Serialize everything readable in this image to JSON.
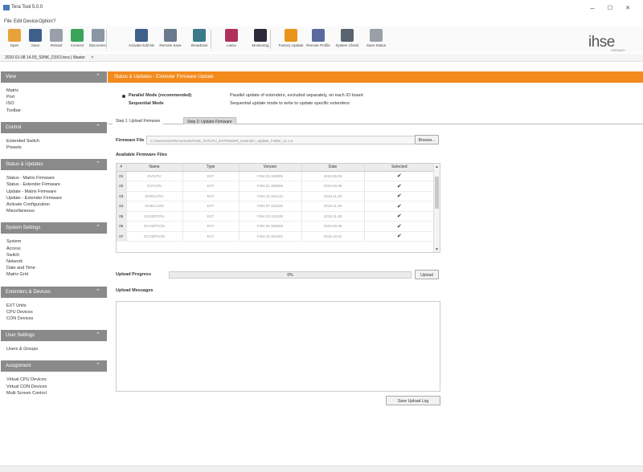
{
  "window": {
    "title": "Tera Tool 5.0.0",
    "controls": [
      "–",
      "☐",
      "✕"
    ]
  },
  "menu": [
    "File",
    "Edit",
    "Device",
    "Option",
    "?"
  ],
  "toolbar": [
    {
      "label": "Open",
      "icon": "open-folder-icon",
      "color": "#e8a23a"
    },
    {
      "label": "Save",
      "icon": "save-icon",
      "color": "#3e5f8a"
    },
    {
      "label": "Reload",
      "icon": "reload-icon",
      "color": "#9aa0a8"
    },
    {
      "label": "Connect",
      "icon": "connect-icon",
      "color": "#3aa55a"
    },
    {
      "label": "Disconnect",
      "icon": "disconnect-icon",
      "color": "#8a96a4"
    },
    {
      "label": "Activate Edit Mode",
      "icon": "edit-mode-icon",
      "color": "#3e5f8a"
    },
    {
      "label": "Remote Save",
      "icon": "remote-save-icon",
      "color": "#6a7a8c"
    },
    {
      "label": "Broadcast",
      "icon": "broadcast-icon",
      "color": "#3a7a8a"
    },
    {
      "label": "Lasso",
      "icon": "lasso-icon",
      "color": "#b0305a"
    },
    {
      "label": "Monitoring",
      "icon": "monitoring-icon",
      "color": "#2a2a3a"
    },
    {
      "label": "Factory Update",
      "icon": "factory-update-icon",
      "color": "#e8941a"
    },
    {
      "label": "Remote Profile",
      "icon": "remote-profile-icon",
      "color": "#5a6aa0"
    },
    {
      "label": "System Check",
      "icon": "system-check-icon",
      "color": "#5a6470"
    },
    {
      "label": "Save Status",
      "icon": "save-status-icon",
      "color": "#9aa0a8"
    }
  ],
  "brand": {
    "name": "ihse",
    "sub": "GERMANY"
  },
  "doc_tab": {
    "label": "2020-01-08 14.59_S0NK_D3X3.tera | Master",
    "close": "×"
  },
  "sidebar": {
    "sections": [
      {
        "title": "View",
        "items": [
          "Matrix",
          "Port",
          "ISO",
          "Toolbar"
        ]
      },
      {
        "title": "Control",
        "items": [
          "Extended Switch",
          "Presets"
        ]
      },
      {
        "title": "Status & Updates",
        "items": [
          "Status - Matrix Firmware",
          "Status - Extender Firmware",
          "Update - Matrix Firmware",
          "Update - Extender Firmware",
          "Activate Configuration",
          "Miscellaneous"
        ]
      },
      {
        "title": "System Settings",
        "items": [
          "System",
          "Access",
          "Switch",
          "Network",
          "Date and Time",
          "Matrix Grid"
        ]
      },
      {
        "title": "Extenders & Devices",
        "items": [
          "EXT Units",
          "CPU Devices",
          "CON Devices"
        ]
      },
      {
        "title": "User Settings",
        "items": [
          "Users & Groups"
        ]
      },
      {
        "title": "Assignment",
        "items": [
          "Virtual CPU Devices",
          "Virtual CON Devices",
          "Multi Screen Control"
        ]
      }
    ]
  },
  "main": {
    "header": "Status & Updates - Extender Firmware Update",
    "modes": [
      {
        "label": "Parallel Mode (recommended)",
        "desc": "Parallel update of extenders, excluded separately, on each IO board",
        "selected": true
      },
      {
        "label": "Sequential Mode",
        "desc": "Sequential update mode to write to update specific extenders",
        "selected": false
      }
    ],
    "tabs": [
      "Step 1: Upload Firmware",
      "Step 2: Update Firmware"
    ],
    "firmware_file_label": "Firmware File",
    "firmware_file_value": "C:/Users/user/Documents/IHSE_DVICPU_EXTENDER_Extender_Update_Folder_v1.1.0",
    "browse_label": "Browse...",
    "available_label": "Available Firmware Files",
    "table": {
      "columns": [
        "#",
        "Name",
        "Type",
        "Version",
        "Date",
        "Selected"
      ],
      "rows": [
        [
          "01",
          "DVICPU",
          "EXT",
          "FW4.01.180905",
          "2018.09.05",
          "✔"
        ],
        [
          "02",
          "DVICON",
          "EXT",
          "FW4.01.180905",
          "2018.09.05",
          "✔"
        ],
        [
          "03",
          "DVIDLCPU",
          "EXT",
          "FW4.10.181120",
          "2018.11.20",
          "✔"
        ],
        [
          "04",
          "DVIDLCON",
          "EXT",
          "FW4.07.181106",
          "2018.11.06",
          "✔"
        ],
        [
          "05",
          "DCXDPCPU",
          "EXT",
          "FW4.02.181108",
          "2018.11.08",
          "✔"
        ],
        [
          "06",
          "DCXDPCON",
          "EXT",
          "FW4.06.180905",
          "2018.09.05",
          "✔"
        ],
        [
          "07",
          "DCXDPCON",
          "EXT",
          "FW4.10.181001",
          "2018.10.01",
          "✔"
        ]
      ]
    },
    "upload_progress_label": "Upload Progress",
    "progress_text": "0%",
    "progress_value": 0,
    "upload_button": "Upload",
    "upload_messages_label": "Upload Messages",
    "save_log_button": "Save Upload Log"
  },
  "colors": {
    "accent": "#f28a1c",
    "sidebar_header": "#8a8a8a"
  }
}
